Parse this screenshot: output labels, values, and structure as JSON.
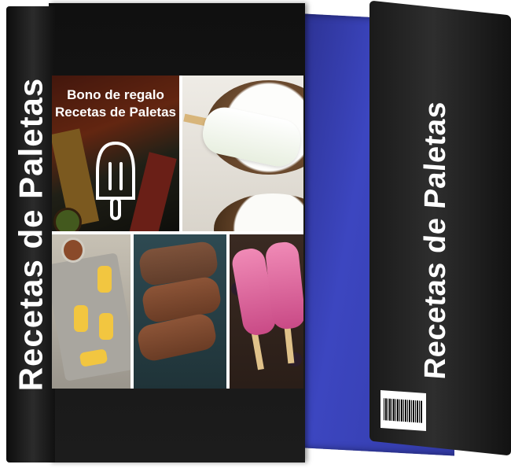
{
  "book": {
    "spine_title": "Recetas de Paletas",
    "gift_line1": "Bono de regalo",
    "gift_line2": "Recetas de Paletas",
    "back_spine_title": "Recetas de Paletas"
  },
  "colors": {
    "front_cover": "#151515",
    "back_cover": "#3640b4",
    "title_text": "#ffffff"
  },
  "icons": {
    "popsicle": "popsicle-icon"
  }
}
